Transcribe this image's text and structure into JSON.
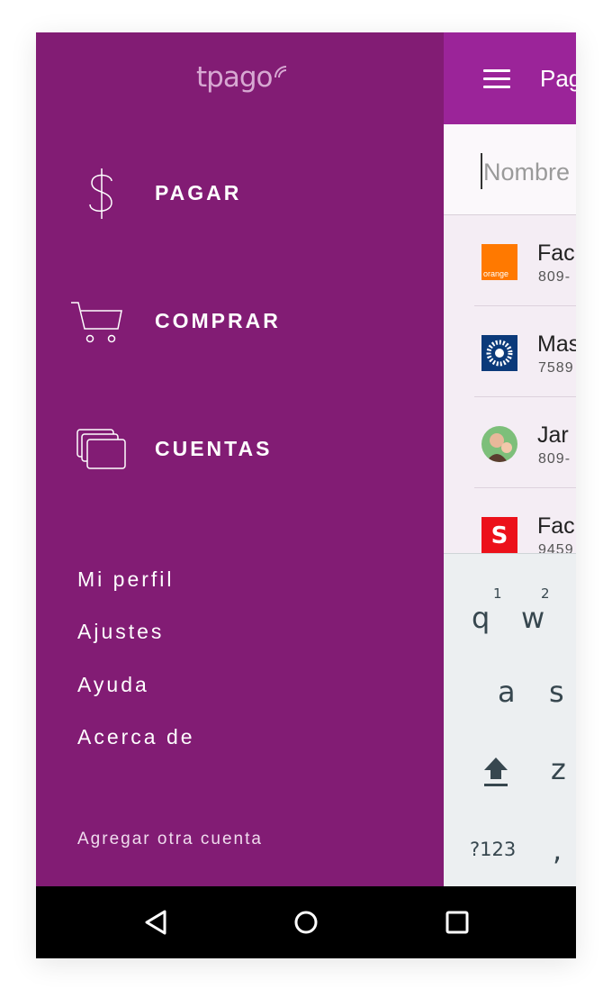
{
  "drawer": {
    "brand": "tpago",
    "primary_items": [
      {
        "label": "PAGAR",
        "icon": "dollar-icon"
      },
      {
        "label": "COMPRAR",
        "icon": "cart-icon"
      },
      {
        "label": "CUENTAS",
        "icon": "cards-icon"
      }
    ],
    "secondary_items": [
      "Mi perfil",
      "Ajustes",
      "Ayuda",
      "Acerca de"
    ],
    "add_account": "Agregar otra cuenta",
    "colors": {
      "background": "#821c74",
      "brand": "#d7a8d2"
    }
  },
  "app": {
    "title": "Pagar",
    "search_placeholder": "Nombre",
    "contacts": [
      {
        "name": "Fac",
        "number": "809-",
        "logo": "orange-logo"
      },
      {
        "name": "Mas",
        "number": "7589",
        "logo": "bank-logo"
      },
      {
        "name": "Jar",
        "number": "809-",
        "logo": "avatar"
      },
      {
        "name": "Fac",
        "number": "9459",
        "logo": "scotiabank-logo"
      }
    ],
    "colors": {
      "appbar": "#9b2499"
    }
  },
  "keyboard": {
    "row1": [
      "q",
      "w"
    ],
    "hints": [
      "1",
      "2"
    ],
    "row2": [
      "a",
      "s"
    ],
    "row3": [
      "z"
    ],
    "symbols": "?123",
    "comma": ","
  },
  "orange_logo_text": "orange",
  "system_nav": [
    "back-icon",
    "home-icon",
    "recents-icon"
  ]
}
